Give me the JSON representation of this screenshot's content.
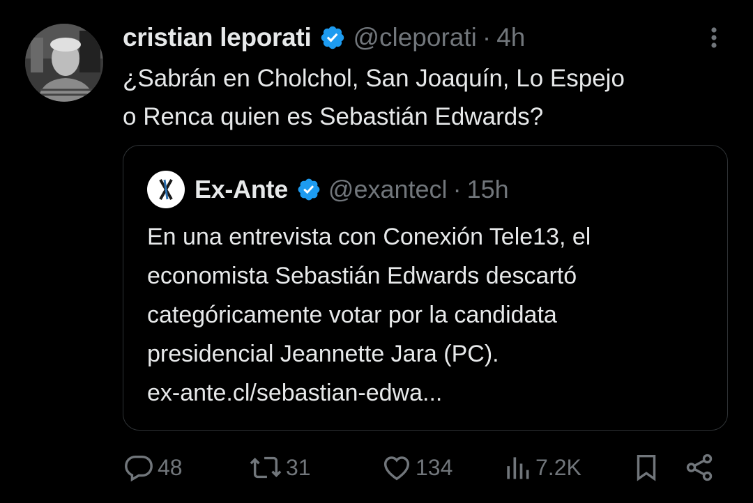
{
  "tweet": {
    "author_name": "cristian leporati",
    "handle": "@cleporati",
    "separator": "·",
    "time": "4h",
    "text_lines": [
      "¿Sabrán en Cholchol, San Joaquín, Lo Espejo",
      "o Renca quien es Sebastián Edwards?"
    ]
  },
  "quote": {
    "author_name": "Ex-Ante",
    "handle": "@exantecl",
    "separator": "·",
    "time": "15h",
    "text_lines": [
      "En una entrevista con Conexión Tele13, el",
      "economista Sebastián Edwards descartó",
      "categóricamente votar por la candidata",
      "presidencial Jeannette Jara (PC).",
      "ex-ante.cl/sebastian-edwa..."
    ]
  },
  "actions": {
    "replies": "48",
    "reposts": "31",
    "likes": "134",
    "views": "7.2K"
  },
  "colors": {
    "background": "#000000",
    "text": "#e7e9ea",
    "muted": "#71767b",
    "verified": "#1d9bf0",
    "border": "#2f3336"
  },
  "icons": [
    "verified-badge-icon",
    "more-options-icon",
    "reply-icon",
    "repost-icon",
    "like-icon",
    "views-icon",
    "bookmark-icon",
    "share-icon"
  ]
}
